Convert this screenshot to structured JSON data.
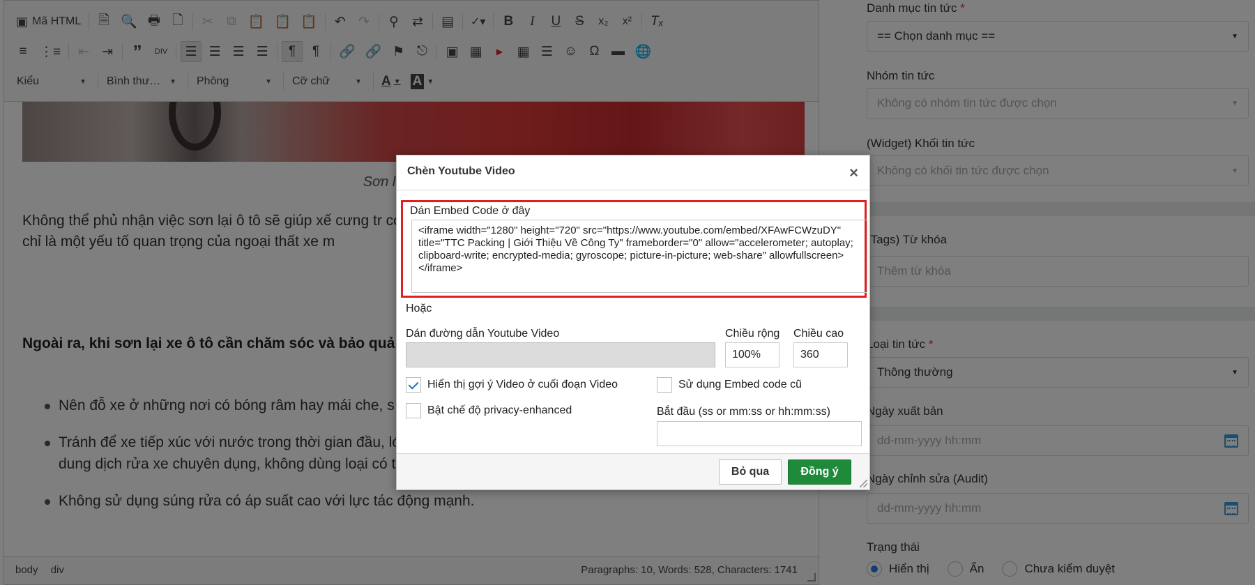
{
  "toolbar": {
    "source_label": "Mã HTML",
    "styles_combo": "Kiểu",
    "format_combo": "Bình thư…",
    "font_combo": "Phông",
    "size_combo": "Cỡ chữ"
  },
  "document": {
    "caption": "Sơn lại xe ô tô đ",
    "paragraph": "Không thể phủ nhận việc sơn lại ô tô sẽ giúp xế cưng tr có màu sắc đẹp và phù hợp với cá tính cũng góp phần không chỉ là một yếu tố quan trọng của ngoại thất xe m",
    "bold_paragraph": "Ngoài ra, khi sơn lại xe ô tô cần chăm sóc và bảo quả xe luôn bền đẹp:",
    "bullets": [
      "Nên đỗ xe ở những nơi có bóng râm hay mái che, s trường.",
      "Tránh để xe tiếp xúc với nước trong thời gian đầu, lớp sơn đã hoàn toàn bám chặt. Lời khuyên là bạn nên dùng dung dịch rửa xe chuyên dụng, không dùng loại có tính tẩy rửa quá mạnh sẽ ăn mòn lớp sơn xe.",
      "Không sử dụng súng rửa có áp suất cao với lực tác động mạnh."
    ]
  },
  "statusbar": {
    "path_body": "body",
    "path_div": "div",
    "counts": "Paragraphs: 10, Words: 528, Characters: 1741"
  },
  "panel": {
    "category_label": "Danh mục tin tức",
    "category_value": "== Chọn danh mục ==",
    "group_label": "Nhóm tin tức",
    "group_placeholder": "Không có nhóm tin tức được chọn",
    "widget_label": "(Widget) Khối tin tức",
    "widget_placeholder": "Không có khối tin tức được chọn",
    "tags_label": "(Tags) Từ khóa",
    "tags_placeholder": "Thêm từ khóa",
    "type_label": "Loại tin tức",
    "type_value": "Thông thường",
    "publish_label": "Ngày xuất bản",
    "publish_placeholder": "dd-mm-yyyy hh:mm",
    "audit_label": "Ngày chỉnh sửa (Audit)",
    "audit_placeholder": "dd-mm-yyyy hh:mm",
    "status_label": "Trạng thái",
    "status_options": [
      "Hiển thị",
      "Ẩn",
      "Chưa kiểm duyệt"
    ],
    "required_mark": "*"
  },
  "dialog": {
    "title": "Chèn Youtube Video",
    "close_symbol": "×",
    "embed_label": "Dán Embed Code ở đây",
    "embed_value": "<iframe width=\"1280\" height=\"720\" src=\"https://www.youtube.com/embed/XFAwFCWzuDY\" title=\"TTC Packing | Giới Thiệu Về Công Ty\" frameborder=\"0\" allow=\"accelerometer; autoplay; clipboard-write; encrypted-media; gyroscope; picture-in-picture; web-share\" allowfullscreen></iframe>",
    "or_label": "Hoặc",
    "url_label": "Dán đường dẫn Youtube Video",
    "url_value": "",
    "width_label": "Chiều rộng",
    "width_value": "100%",
    "height_label": "Chiều cao",
    "height_value": "360",
    "show_related_label": "Hiển thị gợi ý Video ở cuối đoạn Video",
    "show_related_checked": true,
    "old_embed_label": "Sử dụng Embed code cũ",
    "old_embed_checked": false,
    "privacy_label": "Bật chế độ privacy-enhanced",
    "privacy_checked": false,
    "start_label": "Bắt đầu (ss or mm:ss or hh:mm:ss)",
    "start_value": "",
    "cancel_label": "Bỏ qua",
    "ok_label": "Đồng ý"
  },
  "colors": {
    "ok_button": "#1f8a3a",
    "highlight_frame": "#e02020",
    "required": "#d9342b",
    "radio_active": "#2a7ae2"
  }
}
